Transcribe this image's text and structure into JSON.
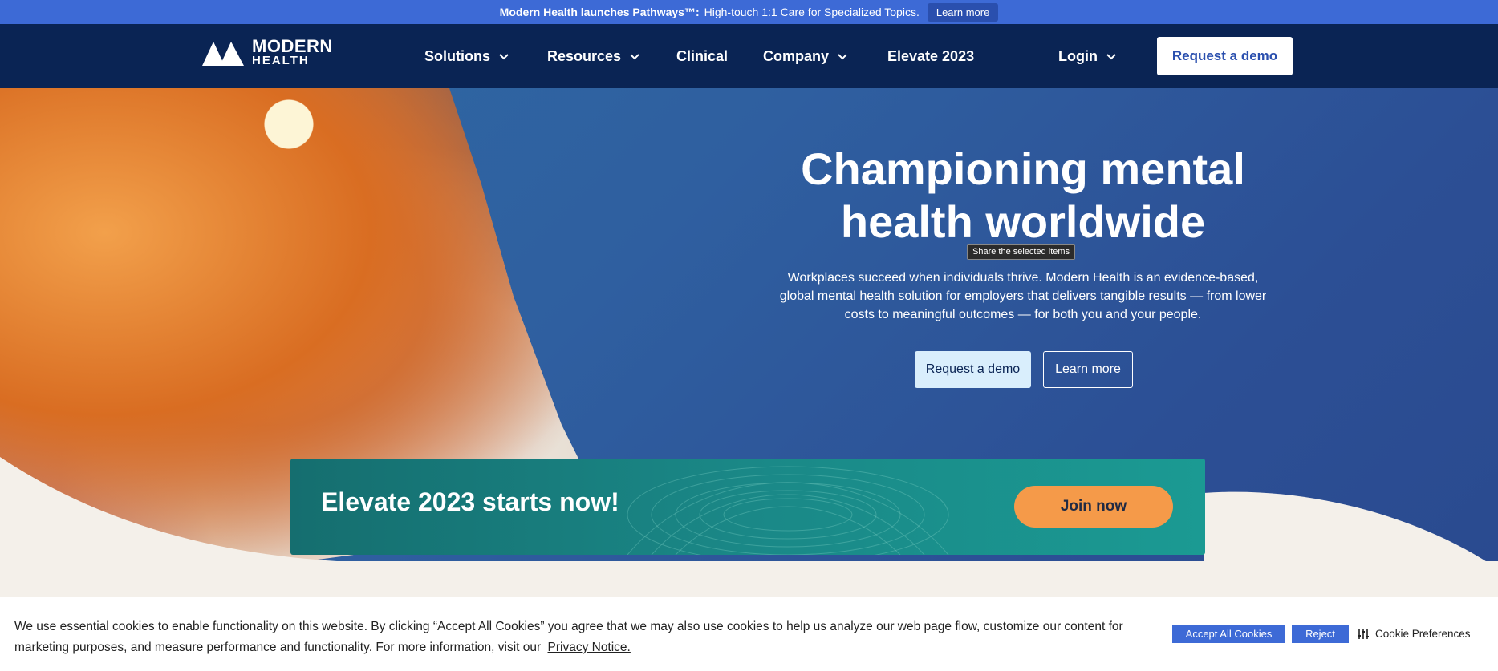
{
  "announcement": {
    "bold": "Modern Health launches Pathways™:",
    "text": "High-touch 1:1 Care for Specialized Topics.",
    "cta": "Learn more"
  },
  "nav": {
    "logo_line1": "MODERN",
    "logo_line2": "HEALTH",
    "items": [
      {
        "label": "Solutions",
        "dropdown": true
      },
      {
        "label": "Resources",
        "dropdown": true
      },
      {
        "label": "Clinical",
        "dropdown": false
      },
      {
        "label": "Company",
        "dropdown": true
      },
      {
        "label": "Elevate 2023",
        "dropdown": false
      }
    ],
    "login": "Login",
    "cta": "Request a demo"
  },
  "hero": {
    "title_line1": "Championing mental",
    "title_line2": "health worldwide",
    "tooltip": "Share the selected items",
    "subtitle": "Workplaces succeed when individuals thrive. Modern Health is an evidence-based, global mental health solution for employers that delivers tangible results — from lower costs to meaningful outcomes — for both you and your people.",
    "primary_cta": "Request a demo",
    "secondary_cta": "Learn more"
  },
  "elevate": {
    "title": "Elevate 2023 starts now!",
    "cta": "Join now"
  },
  "cookie": {
    "text": "We use essential cookies to enable functionality on this website. By clicking “Accept All Cookies” you agree that we may also use cookies to help us analyze our web page flow, customize our content for marketing purposes, and measure performance and functionality. For more information, visit our",
    "link": "Privacy Notice.",
    "accept": "Accept All Cookies",
    "reject": "Reject",
    "preferences": "Cookie Preferences"
  },
  "colors": {
    "announcement_bg": "#3d6ad6",
    "nav_bg": "#0a2454",
    "hero_blue": "#2f5fa0",
    "elevate_teal": "#1a8887",
    "join_orange": "#f59a49",
    "cream": "#f4f0ea"
  }
}
